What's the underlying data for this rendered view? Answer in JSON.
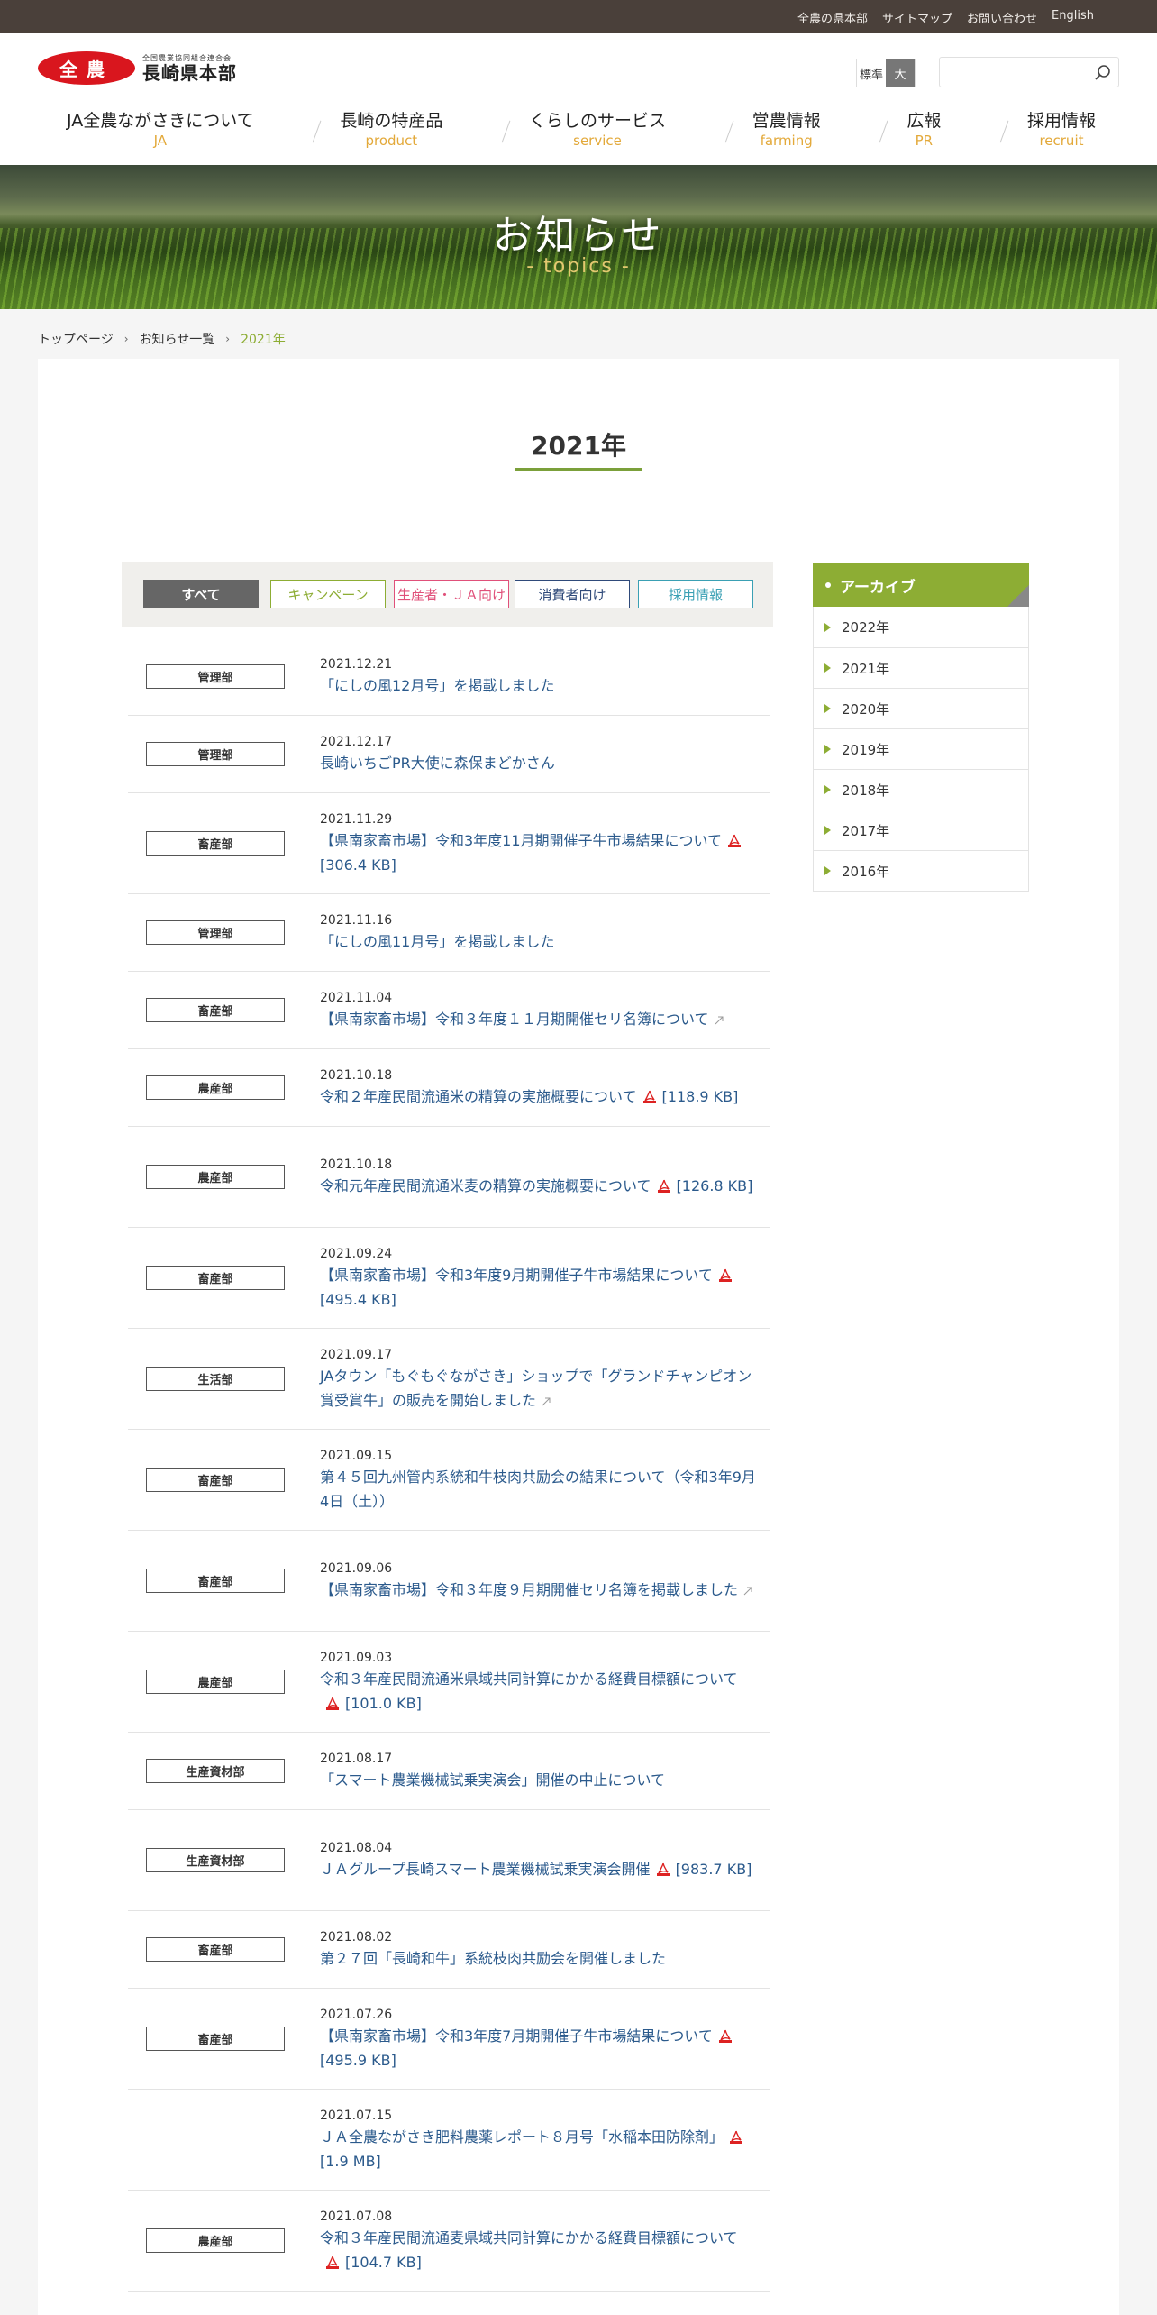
{
  "utility_nav": [
    "全農の県本部",
    "サイトマップ",
    "お問い合わせ",
    "English"
  ],
  "logo": {
    "mark": "全農",
    "sub": "全国農業協同組合連合会",
    "main": "長崎県本部"
  },
  "font_size": {
    "standard": "標準",
    "large": "大"
  },
  "search": {
    "placeholder": ""
  },
  "gnav": [
    {
      "jp": "JA全農ながさきについて",
      "en": "JA"
    },
    {
      "jp": "長崎の特産品",
      "en": "product"
    },
    {
      "jp": "くらしのサービス",
      "en": "service"
    },
    {
      "jp": "営農情報",
      "en": "farming"
    },
    {
      "jp": "広報",
      "en": "PR"
    },
    {
      "jp": "採用情報",
      "en": "recruit"
    }
  ],
  "hero": {
    "title": "お知らせ",
    "subtitle": "- topics -"
  },
  "breadcrumb": [
    "トップページ",
    "お知らせ一覧",
    "2021年"
  ],
  "page_title": "2021年",
  "filters": [
    "すべて",
    "キャンペーン",
    "生産者・ＪＡ向け",
    "消費者向け",
    "採用情報"
  ],
  "news": [
    {
      "cat": "管理部",
      "date": "2021.12.21",
      "title": "「にしの風12月号」を掲載しました"
    },
    {
      "cat": "管理部",
      "date": "2021.12.17",
      "title": "長崎いちごPR大使に森保まどかさん"
    },
    {
      "cat": "畜産部",
      "date": "2021.11.29",
      "title": "【県南家畜市場】令和3年度11月期開催子牛市場結果について",
      "pdf": true,
      "size": "[306.4 KB]"
    },
    {
      "cat": "管理部",
      "date": "2021.11.16",
      "title": "「にしの風11月号」を掲載しました"
    },
    {
      "cat": "畜産部",
      "date": "2021.11.04",
      "title": "【県南家畜市場】令和３年度１１月期開催セリ名簿について",
      "ext": true
    },
    {
      "cat": "農産部",
      "date": "2021.10.18",
      "title": "令和２年産民間流通米の精算の実施概要について",
      "pdf": true,
      "size": "[118.9 KB]"
    },
    {
      "cat": "農産部",
      "date": "2021.10.18",
      "title": "令和元年産民間流通米麦の精算の実施概要について",
      "pdf": true,
      "size": "[126.8 KB]"
    },
    {
      "cat": "畜産部",
      "date": "2021.09.24",
      "title": "【県南家畜市場】令和3年度9月期開催子牛市場結果について",
      "pdf": true,
      "size": "[495.4 KB]"
    },
    {
      "cat": "生活部",
      "date": "2021.09.17",
      "title": "JAタウン「もぐもぐながさき」ショップで「グランドチャンピオン賞受賞牛」の販売を開始しました",
      "ext": true
    },
    {
      "cat": "畜産部",
      "date": "2021.09.15",
      "title": "第４５回九州管内系統和牛枝肉共励会の結果について（令和3年9月4日（土））"
    },
    {
      "cat": "畜産部",
      "date": "2021.09.06",
      "title": "【県南家畜市場】令和３年度９月期開催セリ名簿を掲載しました",
      "ext": true
    },
    {
      "cat": "農産部",
      "date": "2021.09.03",
      "title": "令和３年産民間流通米県域共同計算にかかる経費目標額について",
      "pdf": true,
      "size": "[101.0 KB]"
    },
    {
      "cat": "生産資材部",
      "date": "2021.08.17",
      "title": "「スマート農業機械試乗実演会」開催の中止について"
    },
    {
      "cat": "生産資材部",
      "date": "2021.08.04",
      "title": "ＪＡグループ長崎スマート農業機械試乗実演会開催",
      "pdf": true,
      "size": "[983.7 KB]"
    },
    {
      "cat": "畜産部",
      "date": "2021.08.02",
      "title": "第２７回「長崎和牛」系統枝肉共励会を開催しました"
    },
    {
      "cat": "畜産部",
      "date": "2021.07.26",
      "title": "【県南家畜市場】令和3年度7月期開催子牛市場結果について",
      "pdf": true,
      "size": "[495.9 KB]"
    },
    {
      "cat": "",
      "date": "2021.07.15",
      "title": "ＪＡ全農ながさき肥料農薬レポート８月号「水稲本田防除剤」",
      "pdf": true,
      "size": "[1.9 MB]"
    },
    {
      "cat": "農産部",
      "date": "2021.07.08",
      "title": "令和３年産民間流通麦県域共同計算にかかる経費目標額について",
      "pdf": true,
      "size": "[104.7 KB]"
    }
  ],
  "archive": {
    "title": "アーカイブ",
    "years": [
      "2022年",
      "2021年",
      "2020年",
      "2019年",
      "2018年",
      "2017年",
      "2016年"
    ]
  }
}
